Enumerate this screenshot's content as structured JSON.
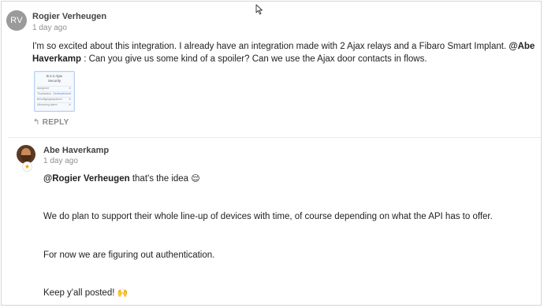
{
  "post1": {
    "avatar_initials": "RV",
    "author": "Rogier Verheugen",
    "date": "1 day ago",
    "text_intro": "I'm so excited about this integration. I already have an integration made with 2 Ajax relays and a Fibaro Smart Implant. ",
    "mention": "@Abe Haverkamp",
    "text_rest": " : Can you give us some kind of a spoiler? Can we use the Ajax door contacts in flows.",
    "attachment": {
      "title_line1": "B.2.2 Ajax",
      "title_line2": "Security",
      "rows": [
        {
          "label": "Aangezet",
          "value": "✕"
        },
        {
          "label": "Thuisstatus",
          "value": "Gedeactiveerd"
        },
        {
          "label": "Beveiligingssysteem",
          "value": "✕"
        },
        {
          "label": "Uitvoering alarm",
          "value": "✕"
        }
      ]
    },
    "reply_label": "REPLY"
  },
  "post2": {
    "author": "Abe Haverkamp",
    "date": "1 day ago",
    "avatar_flair_icon": "star-icon",
    "mention": "@Rogier Verheugen",
    "line1_rest": "  that's the idea ",
    "line1_emoji": "😌",
    "line2": "We do plan to support their whole line-up of devices with time, of course depending on what the API has to offer.",
    "line3": "For now we are figuring out authentication.",
    "line4": "Keep y'all posted! ",
    "line4_emoji": "🙌"
  }
}
